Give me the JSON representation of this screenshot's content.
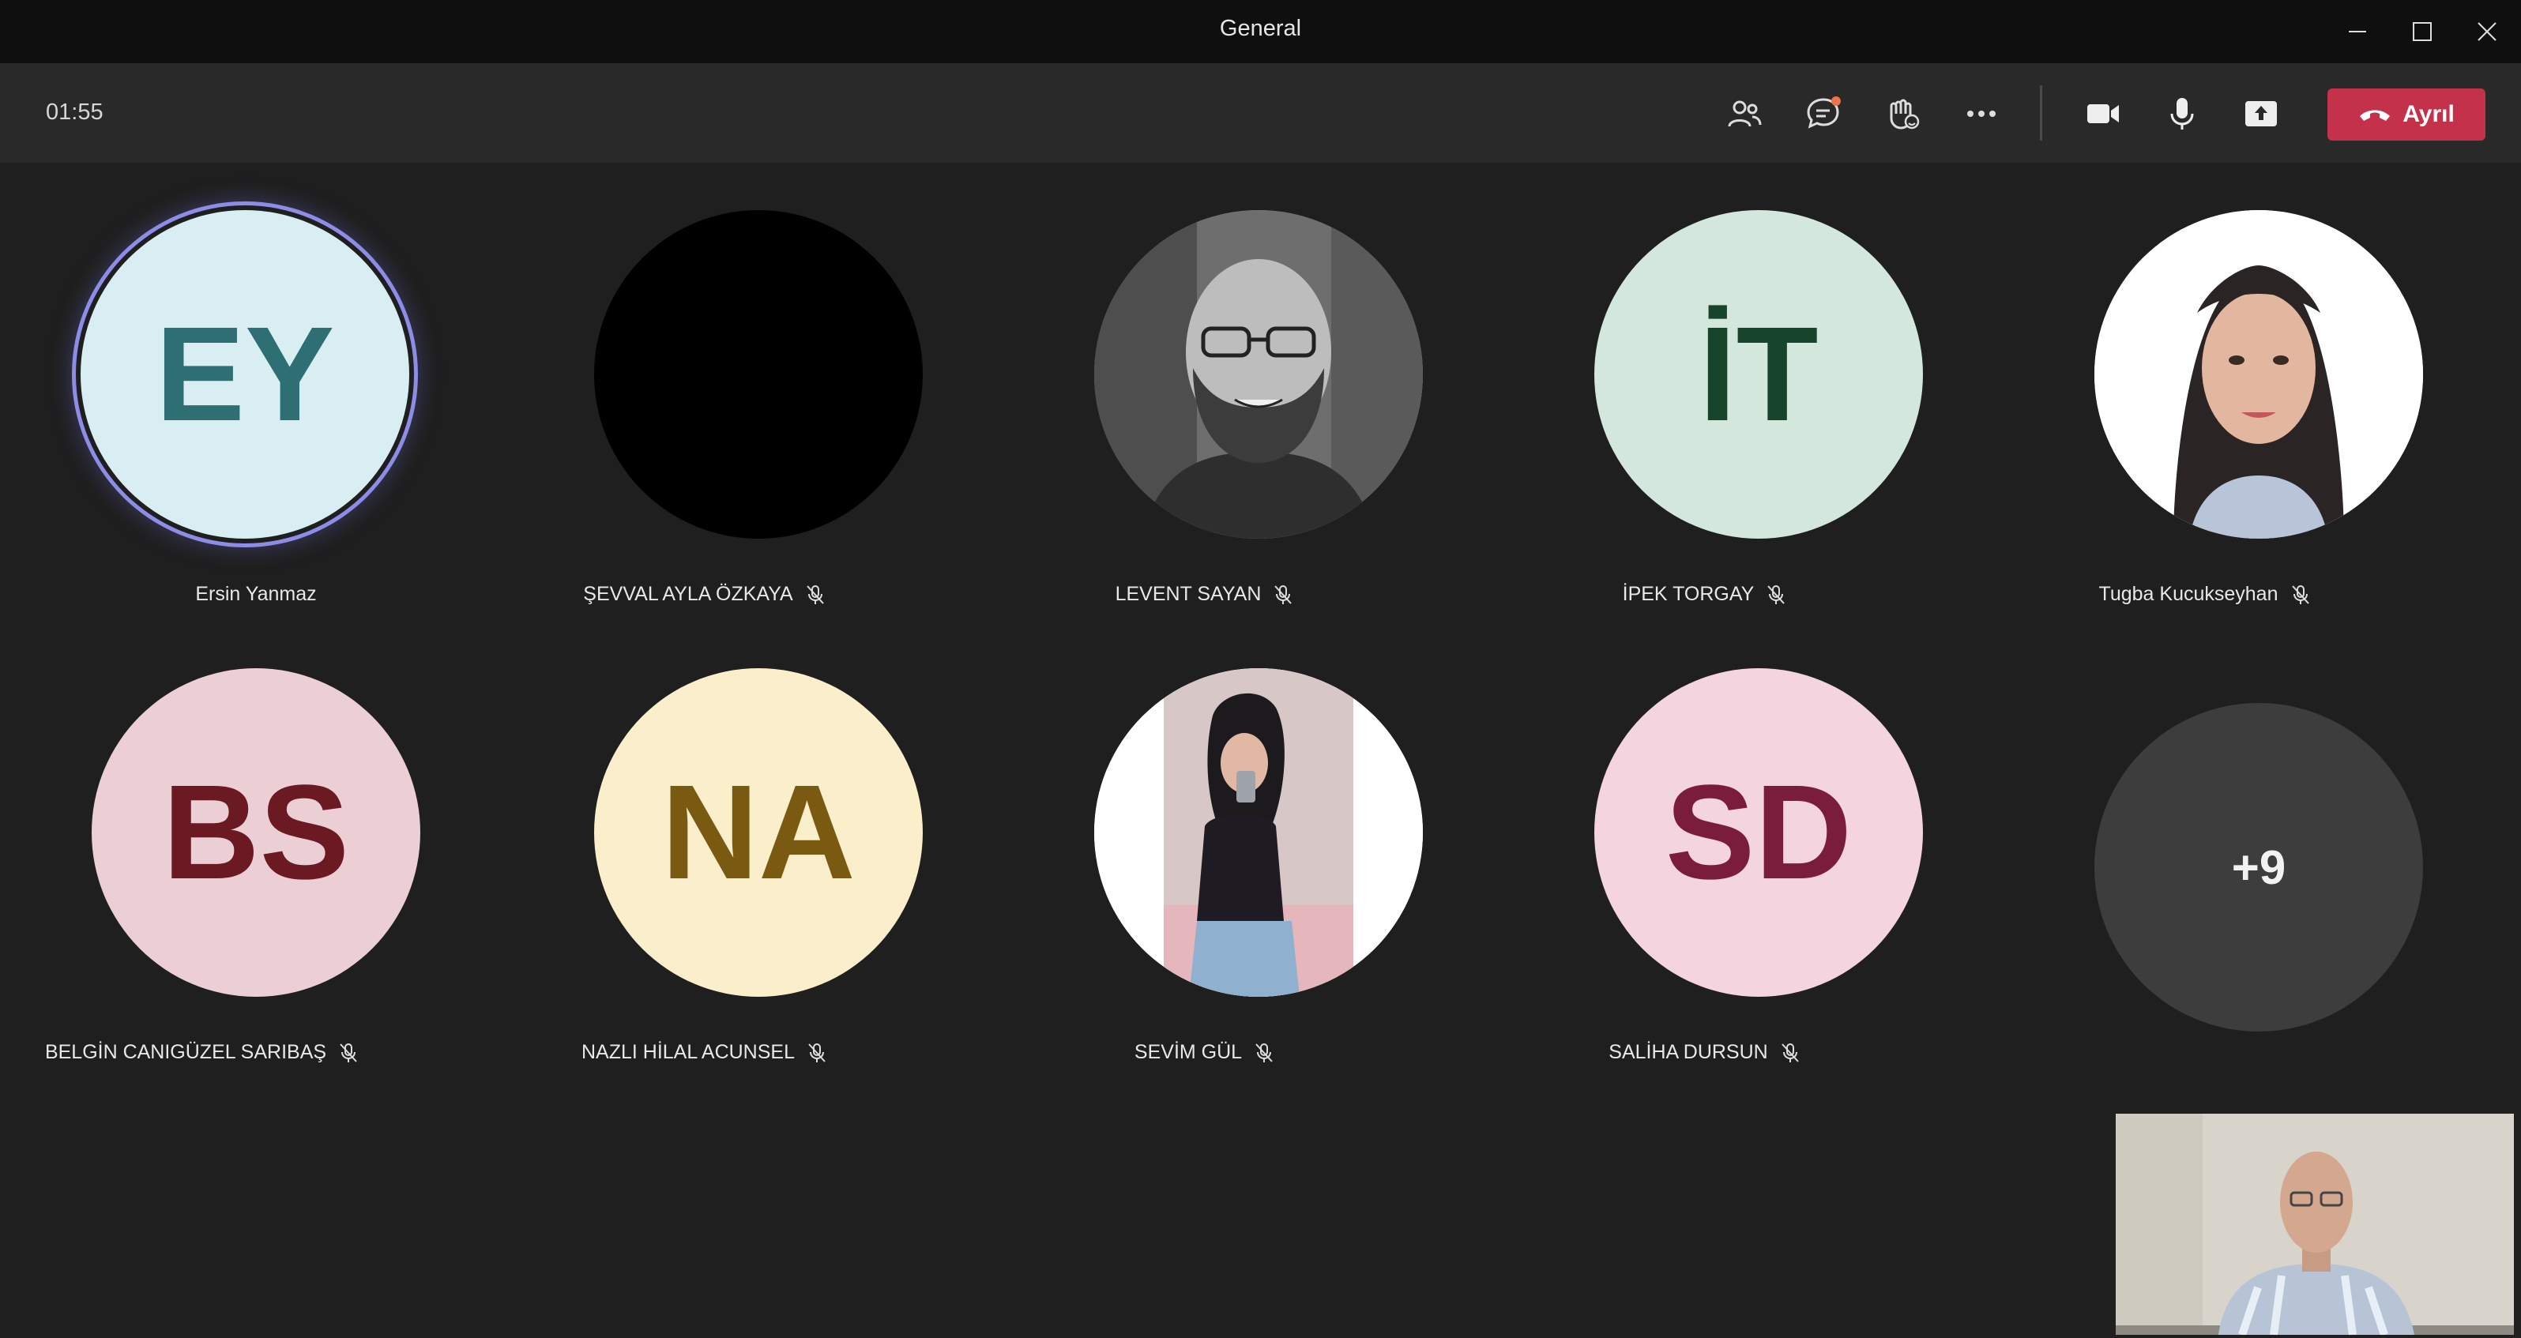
{
  "window": {
    "title": "General"
  },
  "toolbar": {
    "timer": "01:55",
    "icons": [
      "participants-icon",
      "chat-icon",
      "reactions-icon",
      "more-icon",
      "camera-icon",
      "mic-icon",
      "share-icon"
    ],
    "leave_label": "Ayrıl",
    "leave_color": "#c4314b"
  },
  "participants": [
    {
      "initials": "EY",
      "name": "Ersin Yanmaz",
      "muted": false,
      "speaking": true,
      "bg": "#d8eef2",
      "fg": "#2e6f74"
    },
    {
      "initials": "",
      "name": "ŞEVVAL AYLA ÖZKAYA",
      "muted": true,
      "bg": "#000000"
    },
    {
      "initials": "",
      "name": "LEVENT SAYAN",
      "muted": true,
      "photo": "man-gray"
    },
    {
      "initials": "İT",
      "name": "İPEK TORGAY",
      "muted": true,
      "bg": "#d3e7dc",
      "fg": "#17452c"
    },
    {
      "initials": "",
      "name": "Tugba Kucukseyhan",
      "muted": true,
      "photo": "woman-white"
    },
    {
      "initials": "BS",
      "name": "BELGİN CANIGÜZEL SARIBAŞ",
      "muted": true,
      "bg": "#eccfd4",
      "fg": "#6b1a23"
    },
    {
      "initials": "NA",
      "name": "NAZLI HİLAL ACUNSEL",
      "muted": true,
      "bg": "#fbefcb",
      "fg": "#7a5a10"
    },
    {
      "initials": "",
      "name": "SEVİM GÜL",
      "muted": true,
      "photo": "woman-selfie"
    },
    {
      "initials": "SD",
      "name": "SALİHA DURSUN",
      "muted": true,
      "bg": "#f4d4df",
      "fg": "#7a1c3c"
    }
  ],
  "overflow": {
    "label": "+9"
  }
}
